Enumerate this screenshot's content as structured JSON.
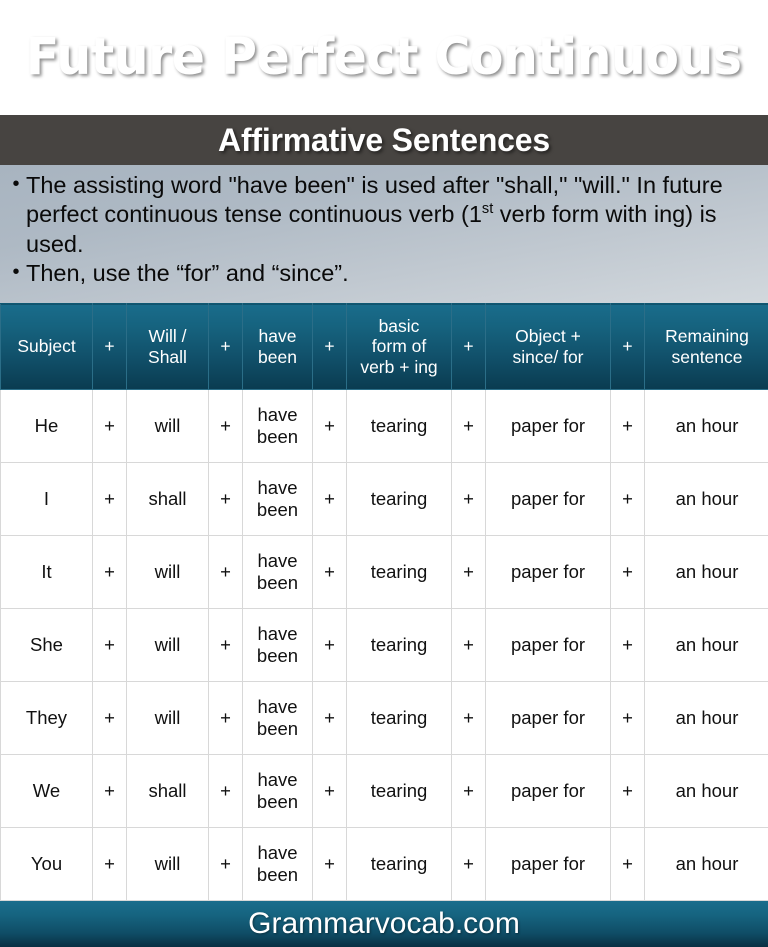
{
  "header": {
    "title": "Future Perfect Continuous",
    "subtitle": "Affirmative Sentences"
  },
  "notes": {
    "bullets": [
      {
        "text_before_sup": "The assisting word \"have been\" is used after \"shall,\" \"will.\"  In future perfect continuous tense continuous verb (1",
        "sup": "st",
        "text_after_sup": " verb form with ing) is used."
      },
      {
        "text_before_sup": "Then, use the “for” and “since”.",
        "sup": "",
        "text_after_sup": ""
      }
    ]
  },
  "table": {
    "columns": [
      {
        "key": "subject",
        "label": "Subject"
      },
      {
        "key": "plus1",
        "label": "+"
      },
      {
        "key": "modal",
        "label": "Will /\nShall"
      },
      {
        "key": "plus2",
        "label": "+"
      },
      {
        "key": "havebeen",
        "label": "have\nbeen"
      },
      {
        "key": "plus3",
        "label": "+"
      },
      {
        "key": "verb",
        "label": "basic\nform of\nverb + ing"
      },
      {
        "key": "plus4",
        "label": "+"
      },
      {
        "key": "object",
        "label": "Object +\nsince/ for"
      },
      {
        "key": "plus5",
        "label": "+"
      },
      {
        "key": "remaining",
        "label": "Remaining\nsentence"
      }
    ],
    "rows": [
      {
        "subject": "He",
        "plus1": "+",
        "modal": "will",
        "plus2": "+",
        "havebeen": "have\nbeen",
        "plus3": "+",
        "verb": "tearing",
        "plus4": "+",
        "object": "paper for",
        "plus5": "+",
        "remaining": "an hour"
      },
      {
        "subject": "I",
        "plus1": "+",
        "modal": "shall",
        "plus2": "+",
        "havebeen": "have\nbeen",
        "plus3": "+",
        "verb": "tearing",
        "plus4": "+",
        "object": "paper for",
        "plus5": "+",
        "remaining": "an hour"
      },
      {
        "subject": "It",
        "plus1": "+",
        "modal": "will",
        "plus2": "+",
        "havebeen": "have\nbeen",
        "plus3": "+",
        "verb": "tearing",
        "plus4": "+",
        "object": "paper for",
        "plus5": "+",
        "remaining": "an hour"
      },
      {
        "subject": "She",
        "plus1": "+",
        "modal": "will",
        "plus2": "+",
        "havebeen": "have\nbeen",
        "plus3": "+",
        "verb": "tearing",
        "plus4": "+",
        "object": "paper for",
        "plus5": "+",
        "remaining": "an hour"
      },
      {
        "subject": "They",
        "plus1": "+",
        "modal": "will",
        "plus2": "+",
        "havebeen": "have\nbeen",
        "plus3": "+",
        "verb": "tearing",
        "plus4": "+",
        "object": "paper for",
        "plus5": "+",
        "remaining": "an hour"
      },
      {
        "subject": "We",
        "plus1": "+",
        "modal": "shall",
        "plus2": "+",
        "havebeen": "have\nbeen",
        "plus3": "+",
        "verb": "tearing",
        "plus4": "+",
        "object": "paper for",
        "plus5": "+",
        "remaining": "an hour"
      },
      {
        "subject": "You",
        "plus1": "+",
        "modal": "will",
        "plus2": "+",
        "havebeen": "have\nbeen",
        "plus3": "+",
        "verb": "tearing",
        "plus4": "+",
        "object": "paper for",
        "plus5": "+",
        "remaining": "an hour"
      }
    ]
  },
  "footer": {
    "site": "Grammarvocab.com"
  },
  "colors": {
    "banner_top": "#196c8b",
    "banner_bottom": "#082f41",
    "subtitle_band": "#474441",
    "notes_bg": "#b4bec8",
    "table_header": "#12566f",
    "grid_line": "#d8d8d8",
    "text": "#111111"
  }
}
